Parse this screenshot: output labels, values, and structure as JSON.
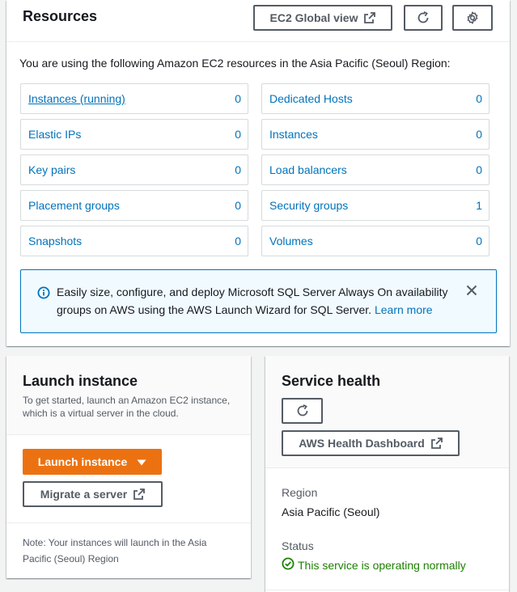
{
  "resources": {
    "title": "Resources",
    "global_view_label": "EC2 Global view",
    "description": "You are using the following Amazon EC2 resources in the Asia Pacific (Seoul) Region:",
    "items": [
      {
        "name": "Instances (running)",
        "count": "0"
      },
      {
        "name": "Dedicated Hosts",
        "count": "0"
      },
      {
        "name": "Elastic IPs",
        "count": "0"
      },
      {
        "name": "Instances",
        "count": "0"
      },
      {
        "name": "Key pairs",
        "count": "0"
      },
      {
        "name": "Load balancers",
        "count": "0"
      },
      {
        "name": "Placement groups",
        "count": "0"
      },
      {
        "name": "Security groups",
        "count": "1"
      },
      {
        "name": "Snapshots",
        "count": "0"
      },
      {
        "name": "Volumes",
        "count": "0"
      }
    ],
    "info_text": "Easily size, configure, and deploy Microsoft SQL Server Always On availability groups on AWS using the AWS Launch Wizard for SQL Server.",
    "info_link": "Learn more"
  },
  "launch": {
    "title": "Launch instance",
    "subtitle": "To get started, launch an Amazon EC2 instance, which is a virtual server in the cloud.",
    "launch_button": "Launch instance",
    "migrate_button": "Migrate a server",
    "note": "Note: Your instances will launch in the Asia Pacific (Seoul) Region"
  },
  "health": {
    "title": "Service health",
    "dashboard_button": "AWS Health Dashboard",
    "region_label": "Region",
    "region_value": "Asia Pacific (Seoul)",
    "status_label": "Status",
    "status_value": "This service is operating normally"
  },
  "colors": {
    "link": "#0073bb",
    "primary": "#ec7211",
    "success": "#1d8102",
    "info_bg": "#f1faff"
  },
  "icons": {
    "external": "external-link-icon",
    "refresh": "refresh-icon",
    "settings": "gear-icon",
    "info": "info-icon",
    "close": "close-icon",
    "caret": "caret-down-icon",
    "success": "check-circle-icon"
  }
}
